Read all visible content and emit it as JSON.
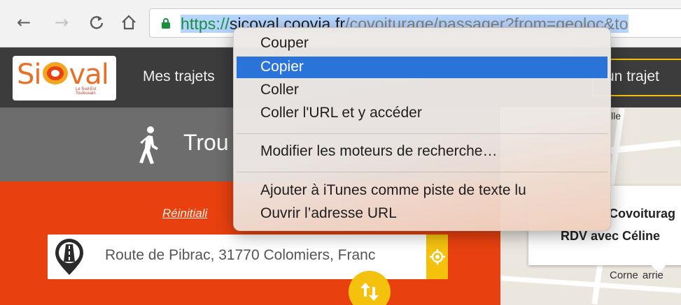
{
  "browser": {
    "back_icon": "←",
    "forward_icon": "→",
    "reload_icon": "C",
    "home_icon": "⌂",
    "url": {
      "scheme": "https://",
      "host": "sicoval.coovia.fr",
      "path": "/covoiturage/passager?from=geoloc&to"
    }
  },
  "site": {
    "logo_text": "Si",
    "logo_text_tail": "val",
    "logo_tagline": "Le Sud-Est Toulousain",
    "nav_my_trips": "Mes trajets",
    "header_button": "un trajet",
    "page_title": "Trou",
    "reset_link": "Réinitiali",
    "address": {
      "value": "Route de Pibrac, 31770 Colomiers, Franc"
    }
  },
  "map": {
    "label_top": "lle",
    "card_title": "Covoiturag",
    "card_subtitle": "RDV avec Céline",
    "label_bottom": "Corne  arrie"
  },
  "context_menu": {
    "items": [
      {
        "label": "Couper"
      },
      {
        "label": "Copier"
      },
      {
        "label": "Coller"
      },
      {
        "label": "Coller l'URL et y accéder"
      },
      {
        "label": "Modifier les moteurs de recherche…"
      },
      {
        "label": "Ajouter à iTunes comme piste de texte lu"
      },
      {
        "label": "Ouvrir l’adresse URL"
      }
    ],
    "active_index": 1
  },
  "colors": {
    "accent_yellow": "#f4c20d",
    "panel_orange": "#e8410f",
    "menu_highlight": "#2a73d9",
    "header_dark": "#3c3c3c"
  }
}
